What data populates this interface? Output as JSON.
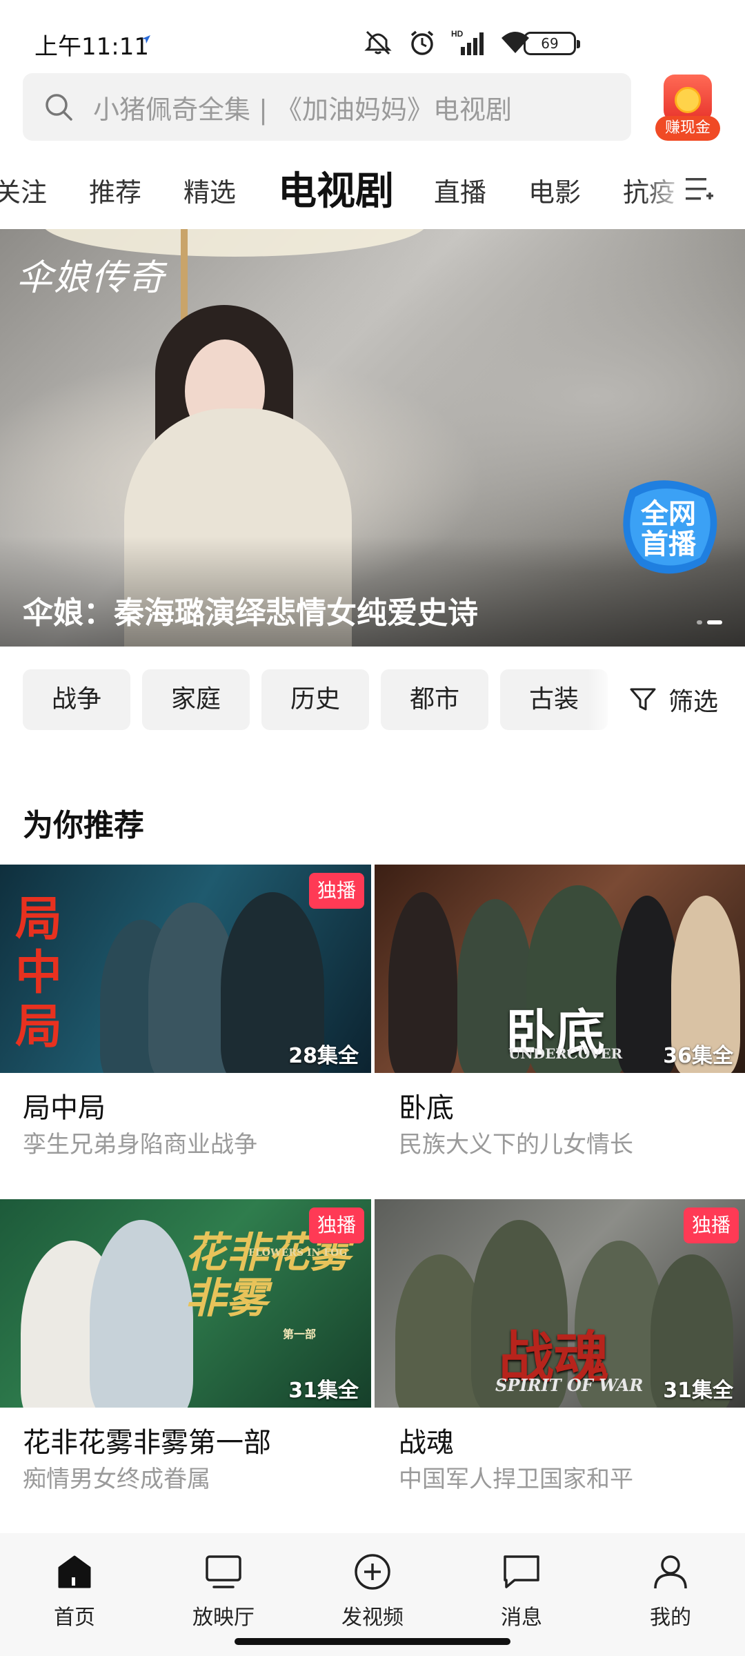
{
  "status_bar": {
    "time": "上午11:11",
    "network_label": "HD",
    "battery": "69"
  },
  "search": {
    "placeholder": "小猪佩奇全集 | 《加油妈妈》电视剧",
    "cash_button_label": "赚现金"
  },
  "tabs": [
    {
      "label": "关注"
    },
    {
      "label": "推荐"
    },
    {
      "label": "精选"
    },
    {
      "label": "电视剧",
      "active": true
    },
    {
      "label": "直播"
    },
    {
      "label": "电影"
    },
    {
      "label": "抗疫"
    }
  ],
  "banner": {
    "logo_text": "伞娘传奇",
    "badge_line1": "全网",
    "badge_line2": "首播",
    "caption": "伞娘：秦海璐演绎悲情女纯爱史诗",
    "active_dot": 2,
    "dot_count": 2
  },
  "genres": [
    "战争",
    "家庭",
    "历史",
    "都市",
    "古装"
  ],
  "filter_label": "筛选",
  "section_title": "为你推荐",
  "cards": [
    {
      "title": "局中局",
      "subtitle": "孪生兄弟身陷商业战争",
      "episodes": "28集全",
      "badge": "独播",
      "poster_text": "局中局"
    },
    {
      "title": "卧底",
      "subtitle": "民族大义下的儿女情长",
      "episodes": "36集全",
      "badge": "",
      "poster_text": "卧底",
      "poster_sub": "UNDERCOVER"
    },
    {
      "title": "花非花雾非雾第一部",
      "subtitle": "痴情男女终成眷属",
      "episodes": "31集全",
      "badge": "独播",
      "poster_text": "花非花雾非雾",
      "poster_sub": "FLOWERS IN FOG",
      "poster_tag": "第一部"
    },
    {
      "title": "战魂",
      "subtitle": "中国军人捍卫国家和平",
      "episodes": "31集全",
      "badge": "独播",
      "poster_text": "战魂",
      "poster_sub": "SPIRIT OF WAR"
    }
  ],
  "bottom_nav": [
    {
      "label": "首页",
      "icon": "home-icon",
      "active": true
    },
    {
      "label": "放映厅",
      "icon": "tv-icon"
    },
    {
      "label": "发视频",
      "icon": "plus-circle-icon"
    },
    {
      "label": "消息",
      "icon": "message-icon"
    },
    {
      "label": "我的",
      "icon": "profile-icon"
    }
  ],
  "colors": {
    "accent_red": "#ff3a55",
    "cash_orange": "#f04a25",
    "chip_bg": "#f2f2f2",
    "muted_text": "#9a9a9a"
  }
}
